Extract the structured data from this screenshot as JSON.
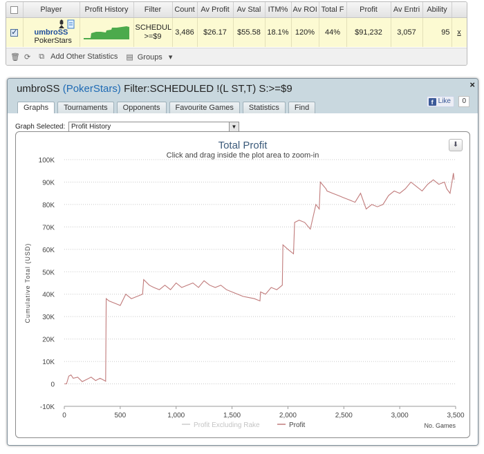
{
  "stats_table": {
    "headers": [
      "",
      "Player",
      "Profit History",
      "Filter",
      "Count",
      "Av Profit",
      "Av Stal",
      "ITM%",
      "Av ROI",
      "Total F",
      "Profit",
      "Av Entri",
      "Ability",
      ""
    ],
    "row": {
      "player_name": "umbroSS",
      "site": "PokerStars",
      "filter_line1": "SCHEDULE",
      "filter_line2": ">=$9",
      "count": "3,486",
      "av_profit": "$26.17",
      "av_stake": "$55.58",
      "itm": "18.1%",
      "av_roi": "120%",
      "total_f": "44%",
      "profit": "$91,232",
      "av_entrants": "3,057",
      "ability": "95",
      "remove": "x"
    },
    "toolbar": {
      "add_stats": "Add Other Statistics",
      "groups": "Groups"
    }
  },
  "panel": {
    "player": "umbroSS",
    "site": "(PokerStars)",
    "filter_text": "Filter:SCHEDULED !(L ST,T) S:>=$9",
    "close": "×",
    "tabs": [
      "Graphs",
      "Tournaments",
      "Opponents",
      "Favourite Games",
      "Statistics",
      "Find"
    ],
    "active_tab": "Graphs",
    "like_label": "Like",
    "like_count": "0",
    "graph_selected_label": "Graph Selected:",
    "graph_selected_value": "Profit History"
  },
  "colors": {
    "profit_line": "#c07a7a",
    "excluding_rake_line": "#cccccc",
    "row_highlight": "#fcfad2",
    "link_blue": "#1e6ab4"
  },
  "chart_data": {
    "type": "line",
    "title": "Total Profit",
    "subtitle": "Click and drag inside the plot area to zoom-in",
    "xlabel": "No. Games",
    "ylabel": "Cumulative Total (USD)",
    "xlim": [
      0,
      3500
    ],
    "ylim": [
      -10000,
      100000
    ],
    "x_ticks": [
      0,
      500,
      1000,
      1500,
      2000,
      2500,
      3000,
      3500
    ],
    "x_tick_labels": [
      "0",
      "500",
      "1,000",
      "1,500",
      "2,000",
      "2,500",
      "3,000",
      "3,500"
    ],
    "y_ticks": [
      -10000,
      0,
      10000,
      20000,
      30000,
      40000,
      50000,
      60000,
      70000,
      80000,
      90000,
      100000
    ],
    "y_tick_labels": [
      "-10K",
      "0",
      "10K",
      "20K",
      "30K",
      "40K",
      "50K",
      "60K",
      "70K",
      "80K",
      "90K",
      "100K"
    ],
    "grid": true,
    "legend": "bottom-center",
    "series": [
      {
        "name": "Profit Excluding Rake",
        "visible": false,
        "x": [],
        "y": []
      },
      {
        "name": "Profit",
        "visible": true,
        "x": [
          0,
          20,
          40,
          60,
          80,
          120,
          160,
          200,
          240,
          280,
          320,
          360,
          370,
          375,
          400,
          450,
          500,
          550,
          600,
          650,
          700,
          710,
          760,
          800,
          850,
          900,
          950,
          1000,
          1050,
          1100,
          1150,
          1200,
          1250,
          1300,
          1350,
          1400,
          1450,
          1500,
          1550,
          1600,
          1650,
          1700,
          1750,
          1755,
          1800,
          1850,
          1900,
          1950,
          1955,
          2000,
          2050,
          2060,
          2100,
          2150,
          2200,
          2250,
          2280,
          2290,
          2340,
          2350,
          2400,
          2450,
          2500,
          2550,
          2600,
          2650,
          2700,
          2750,
          2800,
          2850,
          2900,
          2950,
          3000,
          3050,
          3100,
          3150,
          3200,
          3250,
          3300,
          3350,
          3400,
          3420,
          3450,
          3480,
          3486
        ],
        "y": [
          0,
          0,
          3500,
          4000,
          2500,
          3000,
          1000,
          2000,
          3000,
          1500,
          2500,
          1500,
          1200,
          38000,
          37000,
          36000,
          35000,
          40000,
          38000,
          39000,
          40000,
          46500,
          44000,
          43000,
          42000,
          44000,
          42000,
          45000,
          43000,
          44000,
          45000,
          43000,
          46000,
          44000,
          43000,
          44000,
          42000,
          41000,
          40000,
          39000,
          38500,
          38000,
          37000,
          41000,
          40000,
          43000,
          42000,
          44000,
          62000,
          60000,
          58000,
          72000,
          73000,
          72000,
          69000,
          80000,
          78000,
          90000,
          87000,
          86000,
          85000,
          84000,
          83000,
          82000,
          81000,
          85000,
          78000,
          80000,
          79000,
          80000,
          84000,
          86000,
          85000,
          87000,
          90000,
          88000,
          86000,
          89000,
          91000,
          89000,
          90000,
          87000,
          85000,
          94000,
          91000
        ]
      }
    ]
  }
}
